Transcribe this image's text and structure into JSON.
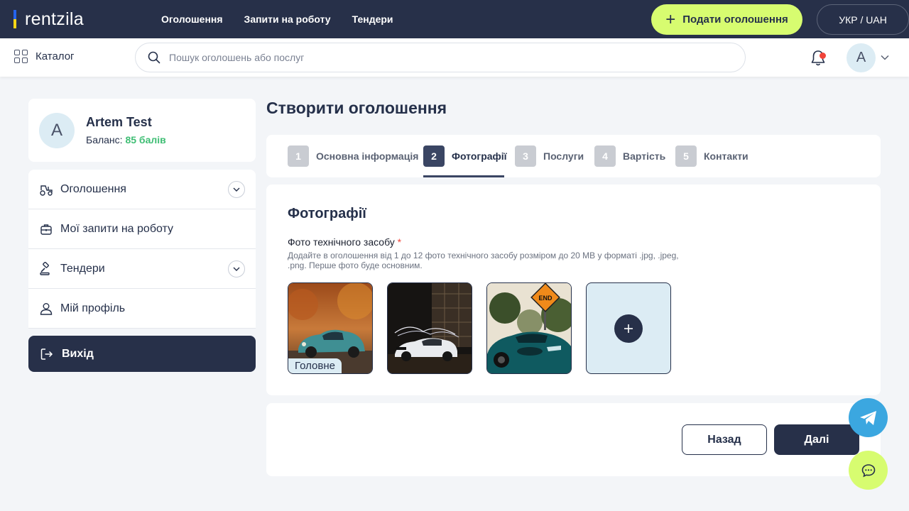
{
  "header": {
    "logo_text": "rentzila",
    "nav": [
      {
        "label": "Оголошення"
      },
      {
        "label": "Запити на роботу"
      },
      {
        "label": "Тендери"
      }
    ],
    "post_button": "Подати оголошення",
    "lang_currency": "УКР / UAH"
  },
  "searchbar": {
    "catalog_label": "Каталог",
    "placeholder": "Пошук оголошень або послуг",
    "user_initial": "A",
    "notification_dot_color": "#f0443a"
  },
  "sidebar": {
    "profile": {
      "initial": "A",
      "name": "Artem Test",
      "balance_label": "Баланс:",
      "balance_value": "85 балів"
    },
    "items": [
      {
        "label": "Оголошення",
        "icon": "tractor-icon",
        "expandable": true
      },
      {
        "label": "Мої запити на роботу",
        "icon": "briefcase-icon",
        "expandable": false
      },
      {
        "label": "Тендери",
        "icon": "gavel-icon",
        "expandable": true
      },
      {
        "label": "Мій профіль",
        "icon": "user-icon",
        "expandable": false
      }
    ],
    "logout_label": "Вихід"
  },
  "main": {
    "title": "Створити оголошення",
    "steps": [
      {
        "num": "1",
        "label": "Основна інформація",
        "active": false
      },
      {
        "num": "2",
        "label": "Фотографії",
        "active": true
      },
      {
        "num": "3",
        "label": "Послуги",
        "active": false
      },
      {
        "num": "4",
        "label": "Вартість",
        "active": false
      },
      {
        "num": "5",
        "label": "Контакти",
        "active": false
      }
    ],
    "photos": {
      "title": "Фотографії",
      "field_label": "Фото технічного засобу",
      "required_mark": "*",
      "hint": "Додайте в оголошення від 1 до 12 фото технічного засобу розміром до 20 MB у форматі .jpg, .jpeg, .png. Перше фото буде основним.",
      "main_badge": "Головне",
      "images": [
        {
          "description": "teal classic sports car in autumn"
        },
        {
          "description": "white muscle car at night with light trails"
        },
        {
          "description": "teal sports car with END road sign"
        }
      ],
      "end_sign_text": "END"
    },
    "nav": {
      "back_label": "Назад",
      "next_label": "Далі"
    }
  },
  "colors": {
    "dark_navy": "#273049",
    "lime": "#d7fc70",
    "accent_green": "#3fbe74",
    "required_red": "#f0443a",
    "telegram_blue": "#3ba7e0"
  }
}
